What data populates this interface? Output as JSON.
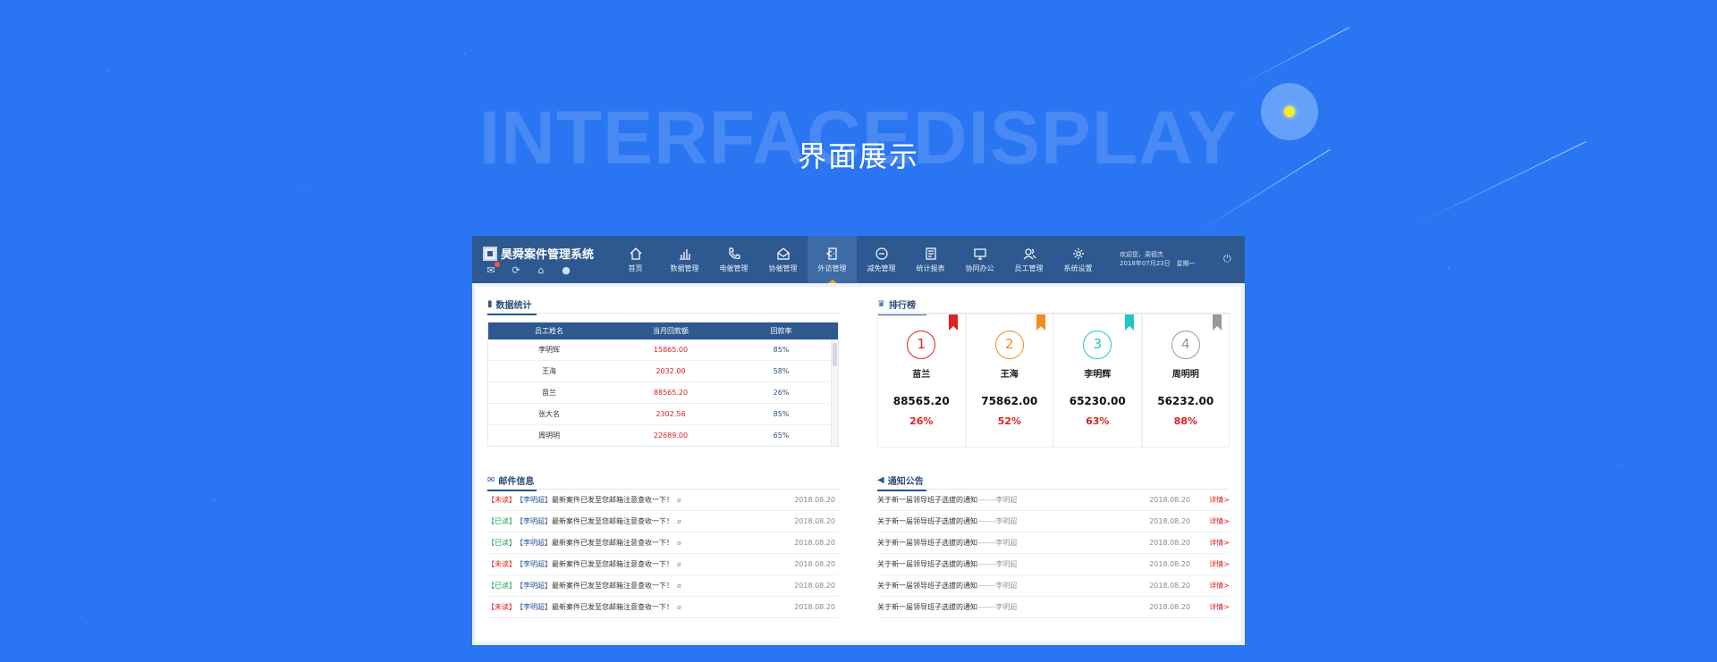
{
  "hero": {
    "bg_title": "INTERFACEDISPLAY",
    "title": "界面展示"
  },
  "app": {
    "brand": "昊舜案件管理系统",
    "brand_icons": [
      "mail-icon",
      "refresh-icon",
      "home-icon",
      "user-icon"
    ],
    "nav": [
      {
        "label": "首页",
        "icon": "home-icon"
      },
      {
        "label": "数据管理",
        "icon": "bar-chart-icon"
      },
      {
        "label": "电催管理",
        "icon": "phone-icon"
      },
      {
        "label": "协催管理",
        "icon": "envelope-open-icon"
      },
      {
        "label": "外访管理",
        "icon": "door-icon",
        "active": true
      },
      {
        "label": "减免管理",
        "icon": "minus-circle-icon"
      },
      {
        "label": "统计报表",
        "icon": "report-icon"
      },
      {
        "label": "协同办公",
        "icon": "monitor-icon"
      },
      {
        "label": "员工管理",
        "icon": "users-icon"
      },
      {
        "label": "系统设置",
        "icon": "gear-icon"
      }
    ],
    "welcome_line1": "欢迎您，周德杰",
    "welcome_line2": "2018年07月23日　星期一",
    "accent": "#f7a11a",
    "header_color": "#2d5990"
  },
  "stats": {
    "title": "数据统计",
    "headers": [
      "员工姓名",
      "当月回款额",
      "回款率"
    ],
    "rows": [
      [
        "李明辉",
        "15865.00",
        "85%"
      ],
      [
        "王海",
        "2032.00",
        "58%"
      ],
      [
        "苗兰",
        "88565.20",
        "26%"
      ],
      [
        "张大名",
        "2302.56",
        "85%"
      ],
      [
        "周明明",
        "22689.00",
        "65%"
      ]
    ]
  },
  "ranking": {
    "title": "排行榜",
    "items": [
      {
        "rank": "1",
        "name": "苗兰",
        "amount": "88565.20",
        "pct": "26%",
        "color": "#e02020"
      },
      {
        "rank": "2",
        "name": "王海",
        "amount": "75862.00",
        "pct": "52%",
        "color": "#f58a1f"
      },
      {
        "rank": "3",
        "name": "李明辉",
        "amount": "65230.00",
        "pct": "63%",
        "color": "#1fc8c0"
      },
      {
        "rank": "4",
        "name": "周明明",
        "amount": "56232.00",
        "pct": "88%",
        "color": "#999999"
      }
    ]
  },
  "mail": {
    "title": "邮件信息",
    "items": [
      {
        "status": "【未读】",
        "status_type": "unread",
        "sender": "【李明超】",
        "text": "最新案件已发至您邮箱注意查收一下！",
        "date": "2018.08.20"
      },
      {
        "status": "【已读】",
        "status_type": "read",
        "sender": "【李明超】",
        "text": "最新案件已发至您邮箱注意查收一下！",
        "date": "2018.08.20"
      },
      {
        "status": "【已读】",
        "status_type": "read",
        "sender": "【李明超】",
        "text": "最新案件已发至您邮箱注意查收一下！",
        "date": "2018.08.20"
      },
      {
        "status": "【未读】",
        "status_type": "unread",
        "sender": "【李明超】",
        "text": "最新案件已发至您邮箱注意查收一下！",
        "date": "2018.08.20"
      },
      {
        "status": "【已读】",
        "status_type": "read",
        "sender": "【李明超】",
        "text": "最新案件已发至您邮箱注意查收一下！",
        "date": "2018.08.20"
      },
      {
        "status": "【未读】",
        "status_type": "unread",
        "sender": "【李明超】",
        "text": "最新案件已发至您邮箱注意查收一下！",
        "date": "2018.08.20"
      }
    ]
  },
  "notice": {
    "title": "通知公告",
    "items": [
      {
        "text": "关于新一届领导班子选拔的通知",
        "author": "-------李明超",
        "date": "2018.08.20",
        "link": "详情>"
      },
      {
        "text": "关于新一届领导班子选拔的通知",
        "author": "-------李明超",
        "date": "2018.08.20",
        "link": "详情>"
      },
      {
        "text": "关于新一届领导班子选拔的通知",
        "author": "-------李明超",
        "date": "2018.08.20",
        "link": "详情>"
      },
      {
        "text": "关于新一届领导班子选拔的通知",
        "author": "-------李明超",
        "date": "2018.08.20",
        "link": "详情>"
      },
      {
        "text": "关于新一届领导班子选拔的通知",
        "author": "-------李明超",
        "date": "2018.08.20",
        "link": "详情>"
      },
      {
        "text": "关于新一届领导班子选拔的通知",
        "author": "-------李明超",
        "date": "2018.08.20",
        "link": "详情>"
      }
    ]
  }
}
